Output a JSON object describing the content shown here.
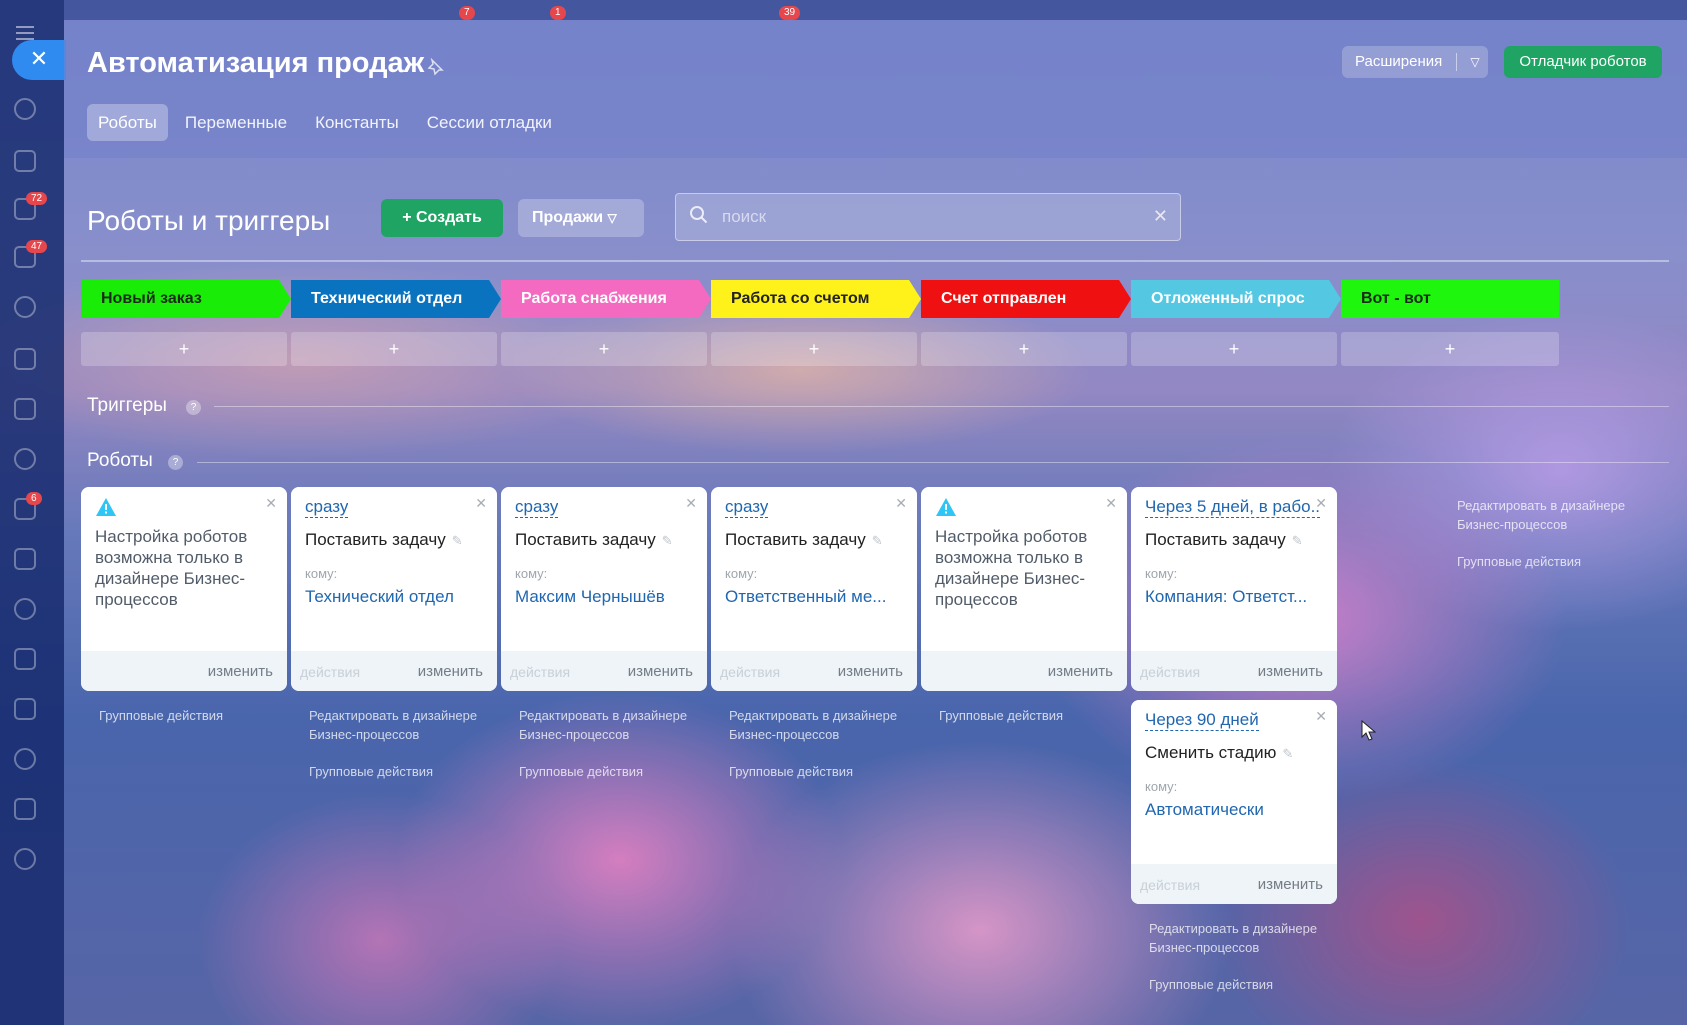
{
  "left_nav": {
    "badges": [
      "72",
      "47",
      "6"
    ]
  },
  "topbar": {
    "badges": [
      "7",
      "1",
      "39"
    ]
  },
  "panel": {
    "title": "Автоматизация продаж",
    "extensions_label": "Расширения",
    "debugger_label": "Отладчик роботов",
    "tabs": [
      {
        "label": "Роботы",
        "active": true
      },
      {
        "label": "Переменные"
      },
      {
        "label": "Константы"
      },
      {
        "label": "Сессии отладки"
      }
    ]
  },
  "section": {
    "title": "Роботы и триггеры",
    "create_label": "Создать",
    "category_label": "Продажи",
    "search_placeholder": "поиск",
    "triggers_label": "Триггеры",
    "robots_label": "Роботы"
  },
  "stages": [
    {
      "name": "Новый заказ",
      "color": "#19ec06",
      "text_color": "#1c2a1c"
    },
    {
      "name": "Технический отдел",
      "color": "#0a73bf",
      "text_color": "#ffffff"
    },
    {
      "name": "Работа снабжения",
      "color": "#f36ac0",
      "text_color": "#ffffff"
    },
    {
      "name": "Работа со счетом",
      "color": "#fff21b",
      "text_color": "#222222"
    },
    {
      "name": "Счет отправлен",
      "color": "#ef1111",
      "text_color": "#ffffff"
    },
    {
      "name": "Отложенный спрос",
      "color": "#54c7e2",
      "text_color": "#ffffff"
    },
    {
      "name": "Вот - вот",
      "color": "#1ef60d",
      "text_color": "#1c2a1c"
    }
  ],
  "add_label": "+",
  "robots": {
    "warning_text": "Настройка роботов возможна только в дизайнере Бизнес-процессов",
    "to_label": "кому:",
    "actions_label": "действия",
    "edit_label": "изменить",
    "set_task": "Поставить задачу",
    "change_stage": "Сменить стадию",
    "delay_now": "сразу",
    "cards": {
      "c2": {
        "to": "Технический отдел"
      },
      "c3": {
        "to": "Максим Чернышёв"
      },
      "c4": {
        "to": "Ответственный ме..."
      },
      "c6": {
        "delay": "Через 5 дней, в рабо...",
        "to": "Компания: Ответст..."
      },
      "c7": {
        "delay": "Через 90 дней",
        "to": "Автоматически"
      }
    },
    "edit_in_designer": "Редактировать в дизайнере Бизнес-процессов",
    "group_actions": "Групповые действия"
  }
}
